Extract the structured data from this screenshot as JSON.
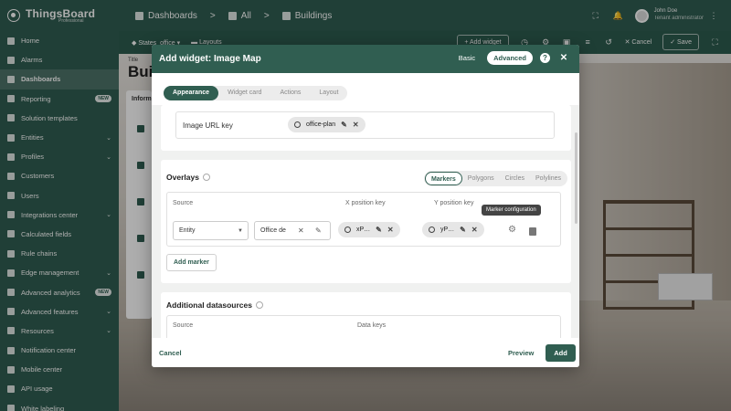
{
  "brand": {
    "name": "ThingsBoard",
    "edition": "Professional"
  },
  "breadcrumbs": [
    "Dashboards",
    "All",
    "Buildings"
  ],
  "user": {
    "name": "John Doe",
    "role": "Tenant administrator"
  },
  "sidebar": {
    "items": [
      {
        "label": "Home",
        "chevron": "",
        "badge": ""
      },
      {
        "label": "Alarms",
        "chevron": "",
        "badge": ""
      },
      {
        "label": "Dashboards",
        "chevron": "",
        "badge": ""
      },
      {
        "label": "Reporting",
        "chevron": "",
        "badge": "NEW"
      },
      {
        "label": "Solution templates",
        "chevron": "",
        "badge": ""
      },
      {
        "label": "Entities",
        "chevron": "⌄",
        "badge": ""
      },
      {
        "label": "Profiles",
        "chevron": "⌄",
        "badge": ""
      },
      {
        "label": "Customers",
        "chevron": "",
        "badge": ""
      },
      {
        "label": "Users",
        "chevron": "",
        "badge": ""
      },
      {
        "label": "Integrations center",
        "chevron": "⌄",
        "badge": ""
      },
      {
        "label": "Calculated fields",
        "chevron": "",
        "badge": ""
      },
      {
        "label": "Rule chains",
        "chevron": "",
        "badge": ""
      },
      {
        "label": "Edge management",
        "chevron": "⌄",
        "badge": ""
      },
      {
        "label": "Advanced analytics",
        "chevron": "",
        "badge": "NEW"
      },
      {
        "label": "Advanced features",
        "chevron": "⌄",
        "badge": ""
      },
      {
        "label": "Resources",
        "chevron": "⌄",
        "badge": ""
      },
      {
        "label": "Notification center",
        "chevron": "",
        "badge": ""
      },
      {
        "label": "Mobile center",
        "chevron": "",
        "badge": ""
      },
      {
        "label": "API usage",
        "chevron": "",
        "badge": ""
      },
      {
        "label": "White labeling",
        "chevron": "",
        "badge": ""
      }
    ]
  },
  "toolbar": {
    "states_label": "States",
    "states_value": "office",
    "layouts_label": "Layouts",
    "add_widget": "+ Add widget",
    "cancel": "Cancel",
    "save": "Save"
  },
  "dashboard": {
    "title_label": "Title",
    "title": "Bui",
    "info_title": "Inform"
  },
  "dialog": {
    "title_prefix": "Add widget:",
    "title": "Image Map",
    "mode_basic": "Basic",
    "mode_advanced": "Advanced",
    "tabs": [
      "Appearance",
      "Widget card",
      "Actions",
      "Layout"
    ],
    "image_url_key_label": "Image URL key",
    "image_url_key_value": "office-plan",
    "overlays_title": "Overlays",
    "overlay_types": [
      "Markers",
      "Polygons",
      "Circles",
      "Polylines"
    ],
    "columns": {
      "source": "Source",
      "x_key": "X position key",
      "y_key": "Y position key"
    },
    "marker_row": {
      "source_type": "Entity",
      "entity": "Office de",
      "x_key": "xP…",
      "y_key": "yP…"
    },
    "tooltip": "Marker configuration",
    "add_marker": "Add marker",
    "additional_title": "Additional datasources",
    "additional_columns": {
      "source": "Source",
      "data_keys": "Data keys"
    },
    "footer": {
      "cancel": "Cancel",
      "preview": "Preview",
      "add": "Add"
    }
  }
}
